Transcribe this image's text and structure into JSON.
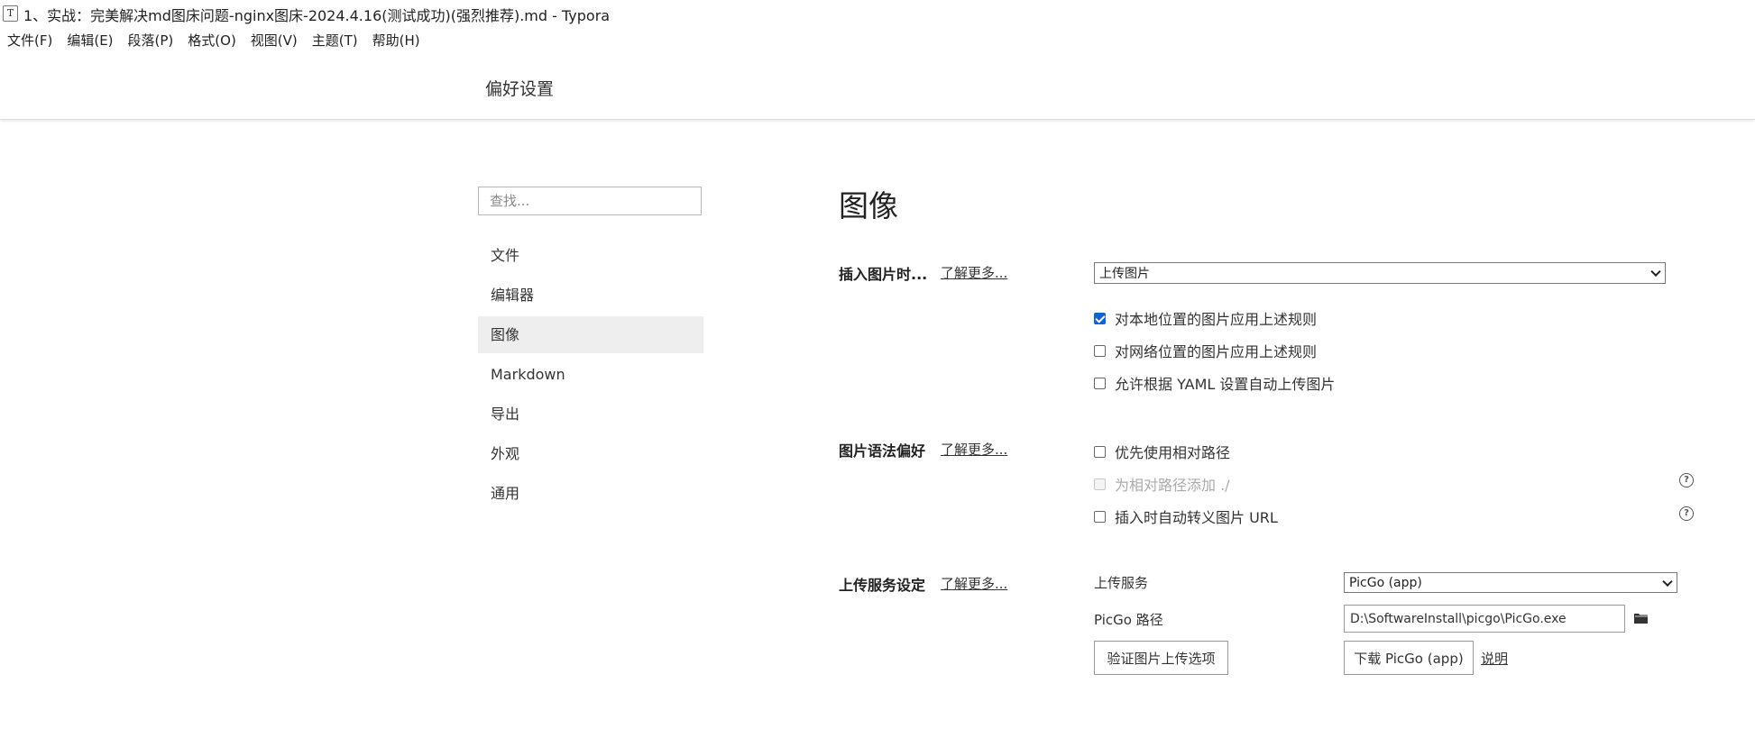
{
  "window": {
    "icon_letter": "T",
    "title": "1、实战：完美解决md图床问题-nginx图床-2024.4.16(测试成功)(强烈推荐).md - Typora"
  },
  "menubar": [
    "文件(F)",
    "编辑(E)",
    "段落(P)",
    "格式(O)",
    "视图(V)",
    "主题(T)",
    "帮助(H)"
  ],
  "preferences": {
    "title": "偏好设置",
    "search_placeholder": "查找..."
  },
  "sidebar": {
    "items": [
      {
        "label": "文件",
        "active": false
      },
      {
        "label": "编辑器",
        "active": false
      },
      {
        "label": "图像",
        "active": true
      },
      {
        "label": "Markdown",
        "active": false
      },
      {
        "label": "导出",
        "active": false
      },
      {
        "label": "外观",
        "active": false
      },
      {
        "label": "通用",
        "active": false
      }
    ]
  },
  "content": {
    "heading": "图像",
    "insert": {
      "label": "插入图片时...",
      "learn_more": "了解更多...",
      "selected": "上传图片",
      "options": [
        {
          "label": "对本地位置的图片应用上述规则",
          "checked": true
        },
        {
          "label": "对网络位置的图片应用上述规则",
          "checked": false
        },
        {
          "label": "允许根据 YAML 设置自动上传图片",
          "checked": false
        }
      ]
    },
    "syntax": {
      "label": "图片语法偏好",
      "learn_more": "了解更多...",
      "options": [
        {
          "label": "优先使用相对路径",
          "checked": false,
          "disabled": false
        },
        {
          "label": "为相对路径添加 ./",
          "checked": false,
          "disabled": true
        },
        {
          "label": "插入时自动转义图片 URL",
          "checked": false,
          "disabled": false
        }
      ],
      "help_symbol": "?"
    },
    "upload": {
      "label": "上传服务设定",
      "learn_more": "了解更多...",
      "service_label": "上传服务",
      "service_selected": "PicGo (app)",
      "path_label": "PicGo 路径",
      "path_value": "D:\\SoftwareInstall\\picgo\\PicGo.exe",
      "verify_button": "验证图片上传选项",
      "download_button": "下载 PicGo (app)",
      "help_link": "说明"
    }
  },
  "colors": {
    "accent": "#0a64d8",
    "active_bg": "#eeeeee",
    "text": "#333333"
  },
  "icons": {
    "folder": "folder-icon",
    "help": "help-circle-icon",
    "chevron": "chevron-down-icon"
  }
}
